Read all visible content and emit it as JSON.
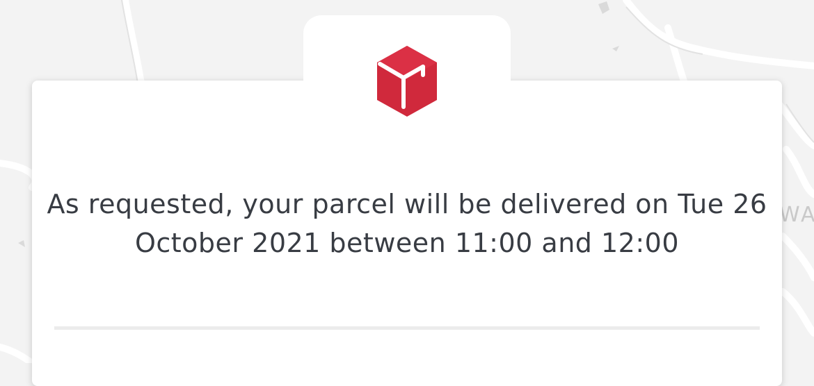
{
  "map": {
    "road_label": "WA"
  },
  "header": {
    "logo_icon": "parcel-box-icon",
    "brand_color": "#dc0032"
  },
  "delivery": {
    "message": "As requested, your parcel will be delivered on Tue 26 October 2021 between 11:00 and 12:00"
  }
}
